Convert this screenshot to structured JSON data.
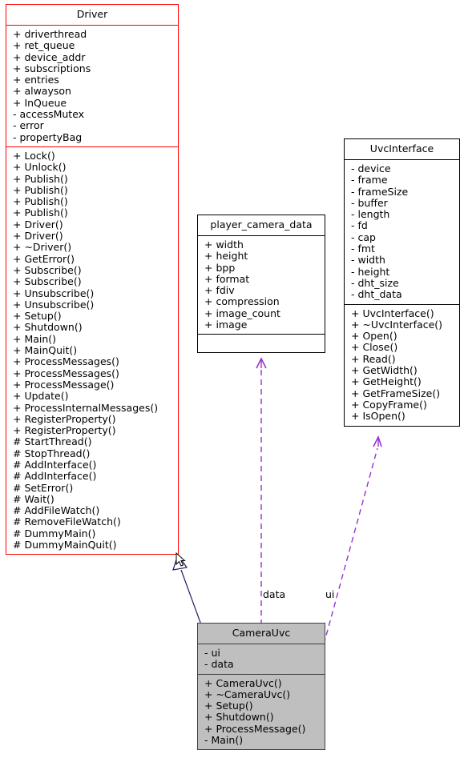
{
  "diagram": {
    "type": "uml-class-diagram",
    "background": "#ffffff",
    "colors": {
      "driver_border": "#ff0000",
      "plain_border": "#000000",
      "highlight_fill": "#bfbfbf",
      "highlight_border": "#3f3f3f",
      "dependency_line": "#9a32cd",
      "inheritance_line": "#1f1f5f"
    }
  },
  "classes": {
    "driver": {
      "name": "Driver",
      "attributes": [
        "+ driverthread",
        "+ ret_queue",
        "+ device_addr",
        "+ subscriptions",
        "+ entries",
        "+ alwayson",
        "+ InQueue",
        "- accessMutex",
        "- error",
        "- propertyBag"
      ],
      "methods": [
        "+ Lock()",
        "+ Unlock()",
        "+ Publish()",
        "+ Publish()",
        "+ Publish()",
        "+ Publish()",
        "+ Driver()",
        "+ Driver()",
        "+ ~Driver()",
        "+ GetError()",
        "+ Subscribe()",
        "+ Subscribe()",
        "+ Unsubscribe()",
        "+ Unsubscribe()",
        "+ Setup()",
        "+ Shutdown()",
        "+ Main()",
        "+ MainQuit()",
        "+ ProcessMessages()",
        "+ ProcessMessages()",
        "+ ProcessMessage()",
        "+ Update()",
        "+ ProcessInternalMessages()",
        "+ RegisterProperty()",
        "+ RegisterProperty()",
        "# StartThread()",
        "# StopThread()",
        "# AddInterface()",
        "# AddInterface()",
        "# SetError()",
        "# Wait()",
        "# AddFileWatch()",
        "# RemoveFileWatch()",
        "# DummyMain()",
        "# DummyMainQuit()"
      ]
    },
    "player_camera_data": {
      "name": "player_camera_data",
      "attributes": [
        "+ width",
        "+ height",
        "+ bpp",
        "+ format",
        "+ fdiv",
        "+ compression",
        "+ image_count",
        "+ image"
      ],
      "methods": []
    },
    "uvc_interface": {
      "name": "UvcInterface",
      "attributes": [
        "- device",
        "- frame",
        "- frameSize",
        "- buffer",
        "- length",
        "- fd",
        "- cap",
        "- fmt",
        "- width",
        "- height",
        "- dht_size",
        "- dht_data"
      ],
      "methods": [
        "+ UvcInterface()",
        "+ ~UvcInterface()",
        "+ Open()",
        "+ Close()",
        "+ Read()",
        "+ GetWidth()",
        "+ GetHeight()",
        "+ GetFrameSize()",
        "+ CopyFrame()",
        "+ IsOpen()"
      ]
    },
    "camera_uvc": {
      "name": "CameraUvc",
      "attributes": [
        "- ui",
        "- data"
      ],
      "methods": [
        "+ CameraUvc()",
        "+ ~CameraUvc()",
        "+ Setup()",
        "+ Shutdown()",
        "+ ProcessMessage()",
        "- Main()"
      ]
    }
  },
  "relationships": [
    {
      "from": "camera_uvc",
      "to": "driver",
      "kind": "inheritance",
      "label": ""
    },
    {
      "from": "camera_uvc",
      "to": "player_camera_data",
      "kind": "dependency",
      "label": "data"
    },
    {
      "from": "camera_uvc",
      "to": "uvc_interface",
      "kind": "dependency",
      "label": "ui"
    }
  ]
}
